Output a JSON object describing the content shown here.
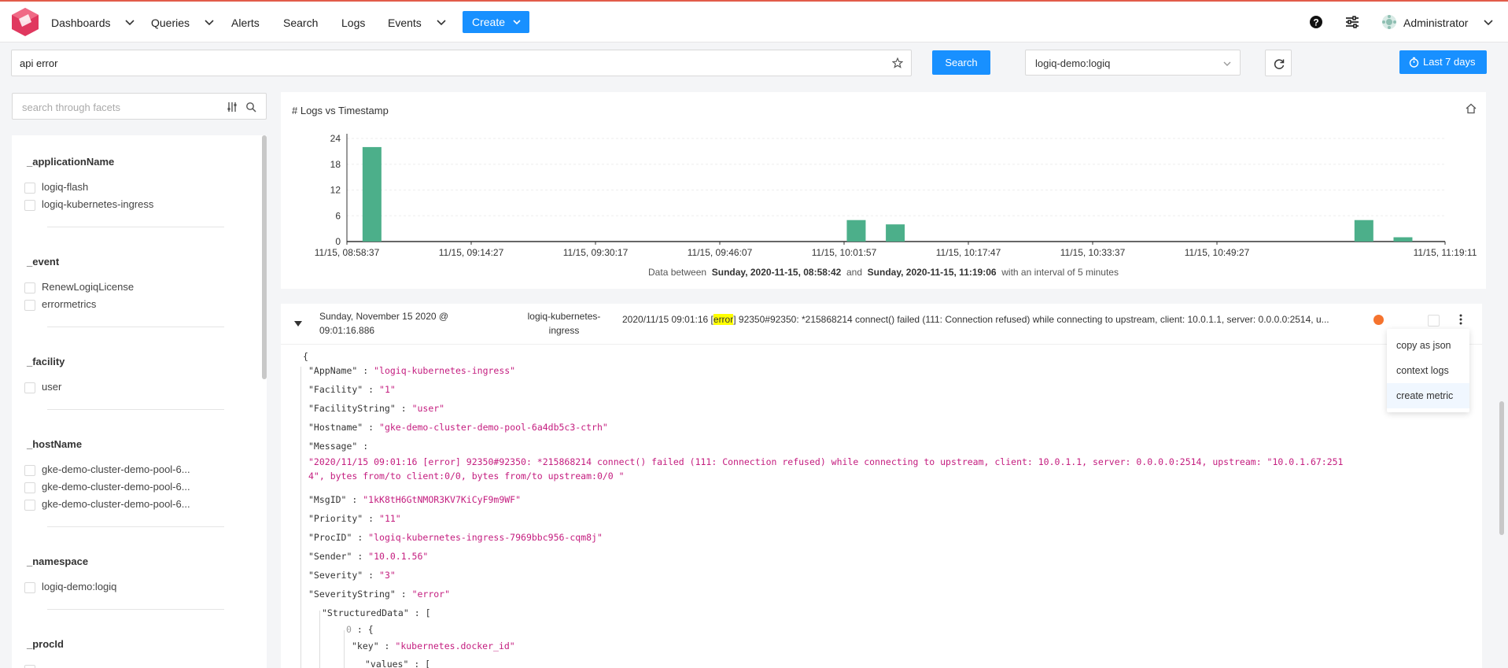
{
  "nav": {
    "items": [
      {
        "label": "Dashboards",
        "has_dropdown": true
      },
      {
        "label": "Queries",
        "has_dropdown": true
      },
      {
        "label": "Alerts",
        "has_dropdown": false
      },
      {
        "label": "Search",
        "has_dropdown": false
      },
      {
        "label": "Logs",
        "has_dropdown": false
      },
      {
        "label": "Events",
        "has_dropdown": true
      }
    ],
    "create_label": "Create",
    "user_label": "Administrator",
    "accent_color": "#1890ff",
    "logo_color": "#e0385f"
  },
  "search": {
    "query_value": "api error",
    "button_label": "Search",
    "namespace_value": "logiq-demo:logiq",
    "time_range_label": "Last 7 days"
  },
  "facets": {
    "search_placeholder": "search through facets",
    "groups": [
      {
        "title": "_applicationName",
        "items": [
          "logiq-flash",
          "logiq-kubernetes-ingress"
        ]
      },
      {
        "title": "_event",
        "items": [
          "RenewLogiqLicense",
          "errormetrics"
        ]
      },
      {
        "title": "_facility",
        "items": [
          "user"
        ]
      },
      {
        "title": "_hostName",
        "items": [
          "gke-demo-cluster-demo-pool-6...",
          "gke-demo-cluster-demo-pool-6...",
          "gke-demo-cluster-demo-pool-6..."
        ]
      },
      {
        "title": "_namespace",
        "items": [
          "logiq-demo:logiq"
        ]
      },
      {
        "title": "_procId",
        "items": []
      }
    ]
  },
  "chart": {
    "caption_prefix": "Data between",
    "caption_start": "Sunday, 2020-11-15, 08:58:42",
    "caption_and": "and",
    "caption_end": "Sunday, 2020-11-15, 11:19:06",
    "caption_suffix": "with an interval of 5 minutes"
  },
  "chart_data": {
    "type": "bar",
    "title": "# Logs vs Timestamp",
    "x_tick_labels": [
      "11/15, 08:58:37",
      "11/15, 09:14:27",
      "11/15, 09:30:17",
      "11/15, 09:46:07",
      "11/15, 10:01:57",
      "11/15, 10:17:47",
      "11/15, 10:33:37",
      "11/15, 10:49:27",
      "11/15, 11:19:11"
    ],
    "y_ticks": [
      0,
      6,
      12,
      18,
      24
    ],
    "ylim": [
      0,
      24
    ],
    "x_range_minutes": [
      0,
      140.6
    ],
    "bar_color": "#4caf8a",
    "bars": [
      {
        "t_minutes": 2,
        "value": 22
      },
      {
        "t_minutes": 64,
        "value": 5
      },
      {
        "t_minutes": 69,
        "value": 4
      },
      {
        "t_minutes": 129,
        "value": 5
      },
      {
        "t_minutes": 134,
        "value": 1
      }
    ]
  },
  "log": {
    "timestamp_line1": "Sunday, November 15 2020 @",
    "timestamp_line2": "09:01:16.886",
    "app_line1": "logiq-kubernetes-",
    "app_line2": "ingress",
    "msg_prefix": "2020/11/15 09:01:16 [",
    "msg_highlight": "error",
    "msg_suffix": "] 92350#92350: *215868214 connect() failed (111: Connection refused) while connecting to upstream, client: 10.0.1.1, server: 0.0.0.0:2514, u...",
    "json": {
      "open_brace": "{",
      "appname_key": "\"AppName\"",
      "appname_val": "\"logiq-kubernetes-ingress\"",
      "facility_key": "\"Facility\"",
      "facility_val": "\"1\"",
      "facilitystring_key": "\"FacilityString\"",
      "facilitystring_val": "\"user\"",
      "hostname_key": "\"Hostname\"",
      "hostname_val": "\"gke-demo-cluster-demo-pool-6a4db5c3-ctrh\"",
      "message_key": "\"Message\"",
      "message_val": "\"2020/11/15 09:01:16 [error] 92350#92350: *215868214 connect() failed (111: Connection refused) while connecting to upstream, client: 10.0.1.1, server: 0.0.0.0:2514, upstream: \"10.0.1.67:2514\", bytes from/to client:0/0, bytes from/to upstream:0/0 \"",
      "msgid_key": "\"MsgID\"",
      "msgid_val": "\"1kK8tH6GtNMOR3KV7KiCyF9m9WF\"",
      "priority_key": "\"Priority\"",
      "priority_val": "\"11\"",
      "procid_key": "\"ProcID\"",
      "procid_val": "\"logiq-kubernetes-ingress-7969bbc956-cqm8j\"",
      "sender_key": "\"Sender\"",
      "sender_val": "\"10.0.1.56\"",
      "severity_key": "\"Severity\"",
      "severity_val": "\"3\"",
      "severitystring_key": "\"SeverityString\"",
      "severitystring_val": "\"error\"",
      "structured_key": "\"StructuredData\"",
      "structured_open": "[",
      "idx0": "0",
      "idx0_open": "{",
      "key_key": "\"key\"",
      "key_val": "\"kubernetes.docker_id\"",
      "values_key": "\"values\"",
      "values_open": "["
    }
  },
  "context_menu": {
    "items": [
      "copy as json",
      "context logs",
      "create metric"
    ],
    "active_index": 2
  }
}
